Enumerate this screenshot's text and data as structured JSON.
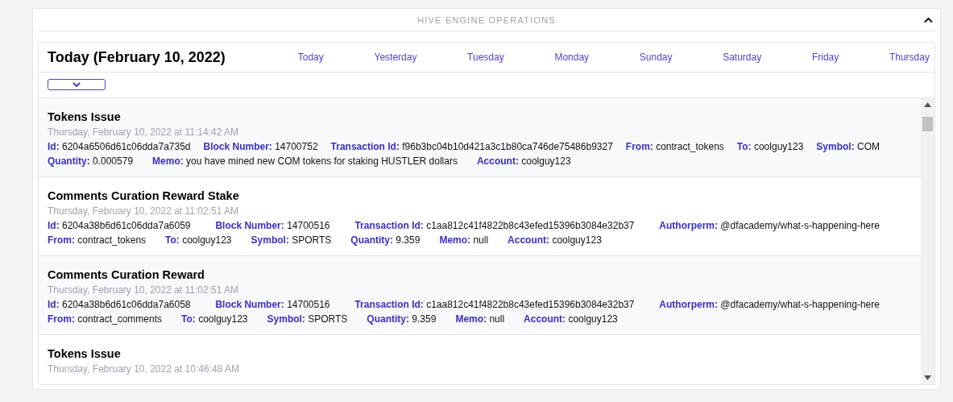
{
  "panel": {
    "title": "HIVE ENGINE OPERATIONS"
  },
  "day_view": {
    "heading": "Today (February 10, 2022)",
    "tabs": [
      "Today",
      "Yesterday",
      "Tuesday",
      "Monday",
      "Sunday",
      "Saturday",
      "Friday",
      "Thursday"
    ],
    "operations": [
      {
        "title": "Tokens Issue",
        "time": "Thursday, February 10, 2022 at 11:14:42 AM",
        "lines": [
          [
            "**Id:** 6204a6506d61c06dda7a735d",
            "**Block Number:** 14700752",
            "**Transaction Id:** f96b3bc04b10d421a3c1b80ca746de75486b9327",
            "**From:** contract_tokens",
            "**To:** coolguy123",
            "**Symbol:** COM"
          ],
          [
            "**Quantity:** 0.000579",
            "**Memo:** you have mined new COM tokens for staking HUSTLER dollars",
            "**Account:** coolguy123"
          ]
        ]
      },
      {
        "title": "Comments Curation Reward Stake",
        "time": "Thursday, February 10, 2022 at 11:02:51 AM",
        "lines": [
          [
            "**Id:** 6204a38b6d61c06dda7a6059",
            "**Block Number:** 14700516",
            "**Transaction Id:** c1aa812c41f4822b8c43efed15396b3084e32b37",
            "**Authorperm:** @dfacademy/what-s-happening-here"
          ],
          [
            "**From:** contract_tokens",
            "**To:** coolguy123",
            "**Symbol:** SPORTS",
            "**Quantity:** 9.359",
            "**Memo:** null",
            "**Account:** coolguy123"
          ]
        ]
      },
      {
        "title": "Comments Curation Reward",
        "time": "Thursday, February 10, 2022 at 11:02:51 AM",
        "lines": [
          [
            "**Id:** 6204a38b6d61c06dda7a6058",
            "**Block Number:** 14700516",
            "**Transaction Id:** c1aa812c41f4822b8c43efed15396b3084e32b37",
            "**Authorperm:** @dfacademy/what-s-happening-here"
          ],
          [
            "**From:** contract_comments",
            "**To:** coolguy123",
            "**Symbol:** SPORTS",
            "**Quantity:** 9.359",
            "**Memo:** null",
            "**Account:** coolguy123"
          ]
        ]
      },
      {
        "title": "Tokens Issue",
        "time": "Thursday, February 10, 2022 at 10:46:48 AM"
      }
    ]
  }
}
